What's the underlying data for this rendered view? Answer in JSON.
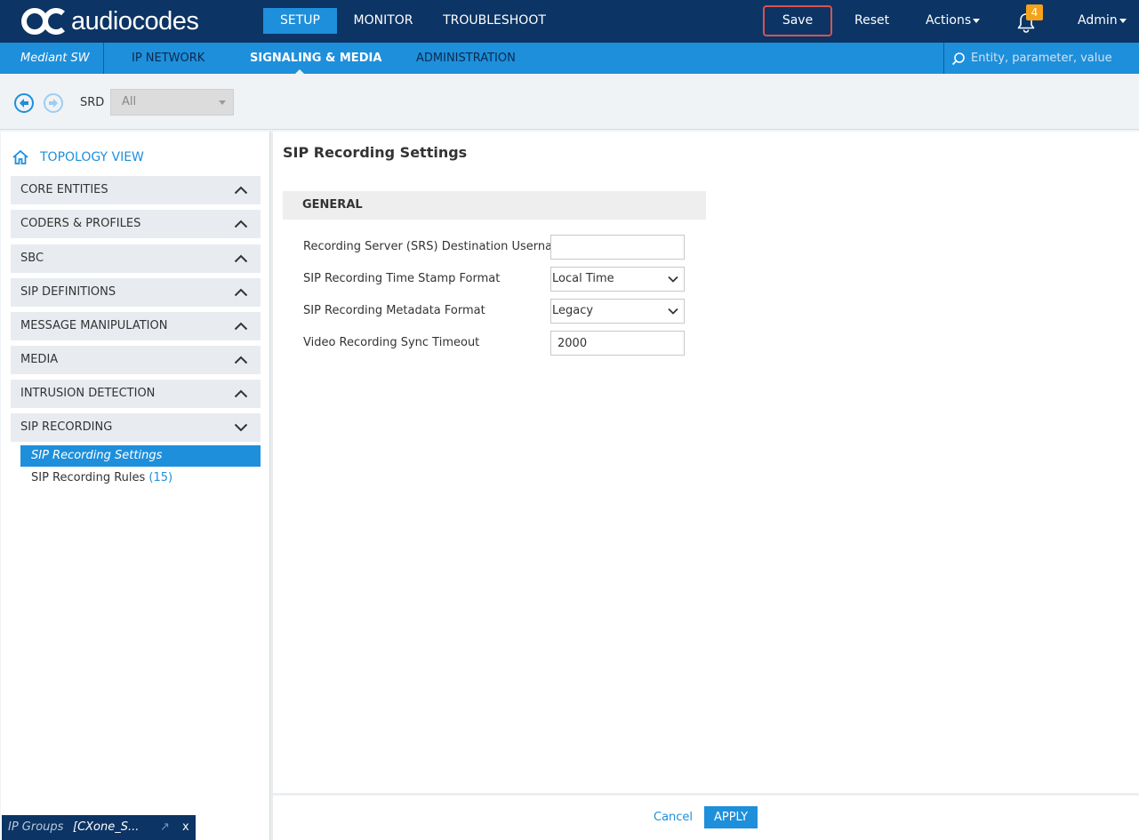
{
  "header": {
    "logo_text": "audiocodes",
    "tabs": [
      {
        "label": "SETUP",
        "active": true
      },
      {
        "label": "MONITOR",
        "active": false
      },
      {
        "label": "TROUBLESHOOT",
        "active": false
      }
    ],
    "save_label": "Save",
    "reset_label": "Reset",
    "actions_label": "Actions",
    "notification_count": "4",
    "user_label": "Admin"
  },
  "subnav": {
    "product": "Mediant SW",
    "tabs": [
      {
        "label": "IP NETWORK",
        "active": false
      },
      {
        "label": "SIGNALING & MEDIA",
        "active": true
      },
      {
        "label": "ADMINISTRATION",
        "active": false
      }
    ],
    "search_placeholder": "Entity, parameter, value"
  },
  "toolbar": {
    "srd_label": "SRD",
    "srd_value": "All"
  },
  "sidebar": {
    "topology_label": "TOPOLOGY VIEW",
    "groups": [
      {
        "label": "CORE ENTITIES",
        "expanded": false
      },
      {
        "label": "CODERS & PROFILES",
        "expanded": false
      },
      {
        "label": "SBC",
        "expanded": false
      },
      {
        "label": "SIP DEFINITIONS",
        "expanded": false
      },
      {
        "label": "MESSAGE MANIPULATION",
        "expanded": false
      },
      {
        "label": "MEDIA",
        "expanded": false
      },
      {
        "label": "INTRUSION DETECTION",
        "expanded": false
      },
      {
        "label": "SIP RECORDING",
        "expanded": true
      }
    ],
    "items": [
      {
        "label": "SIP Recording Settings",
        "count": "",
        "active": true
      },
      {
        "label": "SIP Recording Rules",
        "count": "(15)",
        "active": false
      }
    ]
  },
  "main": {
    "page_title": "SIP Recording Settings",
    "section_title": "GENERAL",
    "fields": [
      {
        "label": "Recording Server (SRS) Destination Username",
        "type": "text",
        "value": ""
      },
      {
        "label": "SIP Recording Time Stamp Format",
        "type": "select",
        "value": "Local Time"
      },
      {
        "label": "SIP Recording Metadata Format",
        "type": "select",
        "value": "Legacy"
      },
      {
        "label": "Video Recording Sync Timeout",
        "type": "text",
        "value": "2000"
      }
    ],
    "cancel_label": "Cancel",
    "apply_label": "APPLY"
  },
  "bottom_tab": {
    "label": "IP Groups",
    "value": "[CXone_S...",
    "close_label": "x"
  },
  "colors": {
    "header_bg": "#0c3464",
    "accent": "#1e8fdb",
    "save_border": "#d9534f",
    "badge": "#f5a21b"
  }
}
